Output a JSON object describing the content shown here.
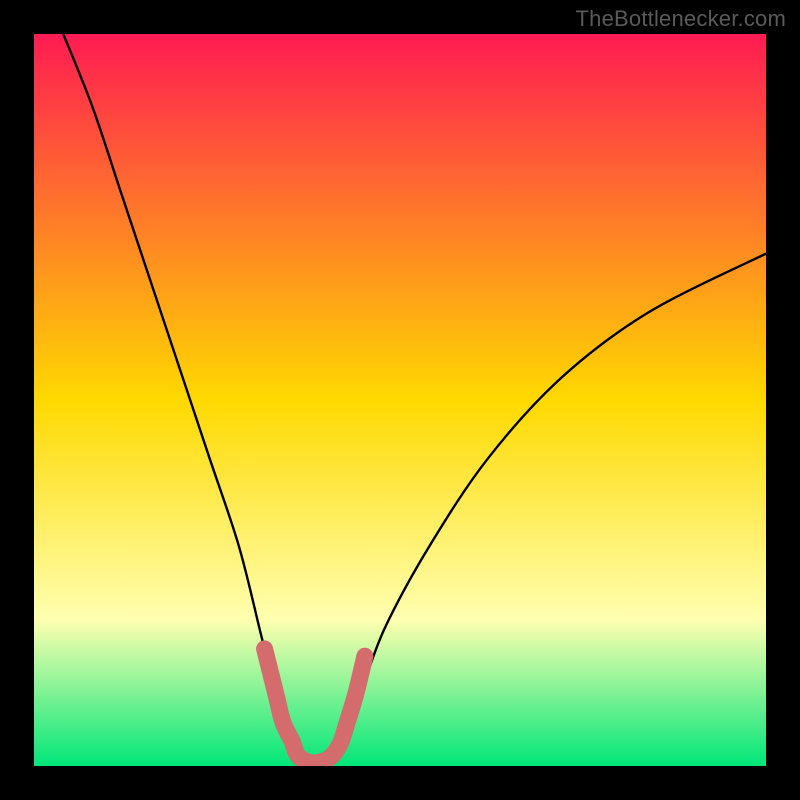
{
  "watermark": "TheBottlenecker.com",
  "colors": {
    "frame": "#000000",
    "gradient_top": "#ff1b52",
    "gradient_mid": "#ffd900",
    "gradient_pale": "#ffffb0",
    "gradient_green": "#00e679",
    "curve": "#000000",
    "marker": "#d46b6c"
  },
  "chart_data": {
    "type": "line",
    "title": "",
    "xlabel": "",
    "ylabel": "",
    "xlim": [
      0,
      100
    ],
    "ylim": [
      0,
      100
    ],
    "series": [
      {
        "name": "bottleneck_curve",
        "x": [
          4,
          8,
          12,
          16,
          20,
          24,
          28,
          31,
          33,
          35,
          36,
          38,
          40,
          42,
          43,
          45,
          48,
          54,
          62,
          72,
          84,
          100
        ],
        "y": [
          100,
          90,
          78,
          66,
          54,
          42,
          30,
          18,
          10,
          4,
          1,
          0,
          0,
          2,
          5,
          11,
          19,
          30,
          42,
          53,
          62,
          70
        ]
      }
    ],
    "markers": {
      "name": "highlight_segment",
      "x": [
        31.5,
        33.0,
        34.0,
        35.2,
        36.0,
        37.5,
        39.0,
        40.5,
        41.8,
        42.8,
        44.0,
        45.2
      ],
      "y": [
        16.0,
        10.0,
        6.0,
        3.5,
        1.5,
        0.5,
        0.5,
        1.2,
        3.0,
        6.0,
        10.0,
        15.0
      ]
    },
    "grid": false,
    "legend": false
  }
}
